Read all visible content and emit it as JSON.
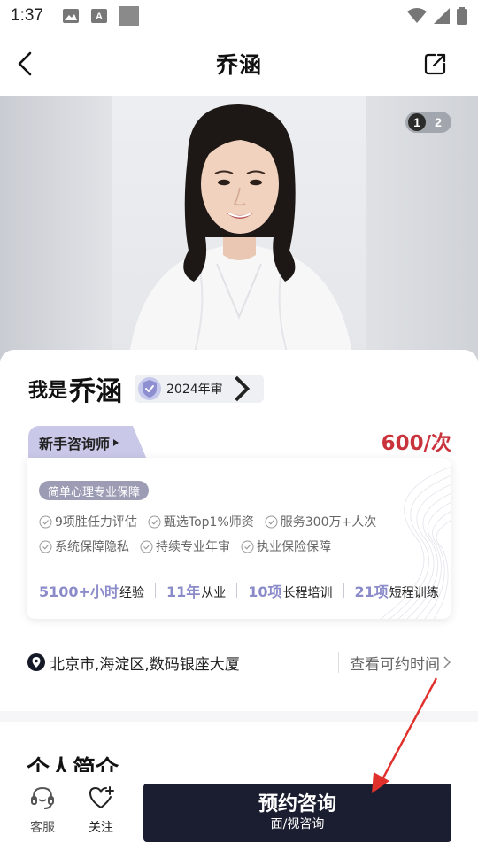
{
  "status_bar": {
    "time": "1:37"
  },
  "nav": {
    "title": "乔涵"
  },
  "hero": {
    "pager_current": "1",
    "pager_total": "2"
  },
  "profile": {
    "name_prefix": "我是",
    "name": "乔涵",
    "review_badge": "2024年审",
    "level": "新手咨询师",
    "price": "600/次",
    "guarantee_tag": "简单心理专业保障",
    "checks": [
      "9项胜任力评估",
      "甄选Top1%师资",
      "服务300万+人次",
      "系统保障隐私",
      "持续专业年审",
      "执业保险保障"
    ],
    "stats": [
      {
        "num": "5100+小时",
        "unit": "经验"
      },
      {
        "num": "11年",
        "unit": "从业"
      },
      {
        "num": "10项",
        "unit": "长程培训"
      },
      {
        "num": "21项",
        "unit": "短程训练"
      }
    ],
    "location": "北京市,海淀区,数码银座大厦",
    "availability_link": "查看可约时间"
  },
  "section": {
    "intro_title": "个人简介"
  },
  "bottom_bar": {
    "service_label": "客服",
    "follow_label": "关注",
    "book_main": "预约咨询",
    "book_sub": "面/视咨询"
  },
  "colors": {
    "accent_purple": "#8b8bc9",
    "price_red": "#c9343c",
    "button_dark": "#1b1e30",
    "level_tab": "#c9c8e8"
  }
}
